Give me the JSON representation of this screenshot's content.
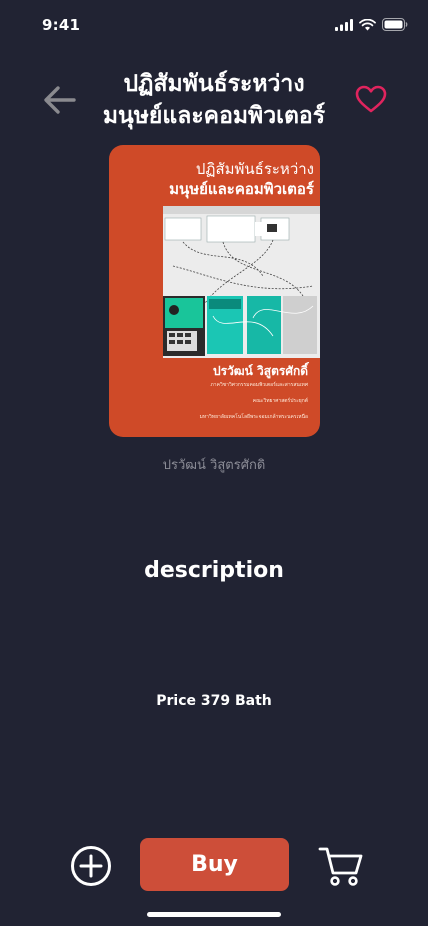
{
  "status_bar": {
    "time": "9:41",
    "icons": [
      "signal-icon",
      "wifi-icon",
      "battery-icon"
    ]
  },
  "header": {
    "back_icon": "arrow-left-icon",
    "title_line1": "ปฏิสัมพันธ์ระหว่าง",
    "title_line2": "มนุษย์และคอมพิวเตอร์",
    "favorite_icon": "heart-outline-icon"
  },
  "book": {
    "cover": {
      "title_line1": "ปฏิสัมพันธ์ระหว่าง",
      "title_line2": "มนุษย์และคอมพิวเตอร์",
      "author": "ปรวัฒน์ วิสูตรศักดิ์",
      "line1": "ภาควิชาวิศวกรรมคอมพิวเตอร์และสารสนเทศ",
      "line2": "คณะวิทยาศาสตร์ประยุกต์",
      "line3": "มหาวิทยาลัยเทคโนโลยีพระจอมเกล้าพระนครเหนือ",
      "background_color": "#cf4a28"
    },
    "author": "ปรวัฒน์ วิสูตรศักดิ",
    "description_heading": "description",
    "price_text": "Price 379 Bath"
  },
  "actions": {
    "add_icon": "plus-circle-icon",
    "buy_label": "Buy",
    "cart_icon": "shopping-cart-icon"
  },
  "colors": {
    "background": "#212333",
    "accent": "#cd4e39",
    "heart": "#e0245e",
    "muted_text": "#8b8c96"
  }
}
